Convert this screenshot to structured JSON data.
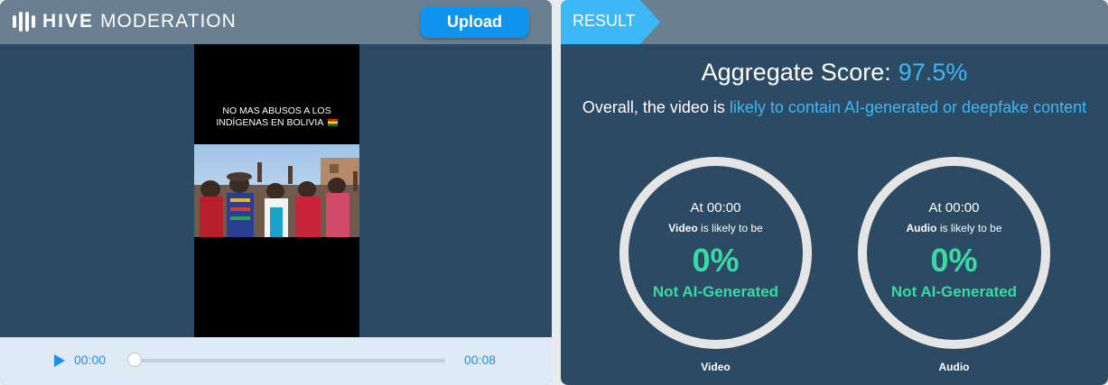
{
  "app": {
    "logo_bold": "HIVE",
    "logo_light": "MODERATION",
    "upload_label": "Upload",
    "logo_icon": "hive-bars-icon"
  },
  "video": {
    "caption_line1": "NO MAS ABUSOS A LOS",
    "caption_line2": "INDÍGENAS EN BOLIVIA",
    "caption_flag": "bolivia-flag-icon",
    "current_time": "00:00",
    "duration": "00:08",
    "progress": 0
  },
  "result": {
    "tag": "RESULT",
    "aggregate_label": "Aggregate Score:",
    "aggregate_value": "97.5%",
    "overall_prefix": "Overall, the video is ",
    "overall_highlight": "likely to contain AI-generated or deepfake content",
    "modalities": [
      {
        "at_label": "At 00:00",
        "name": "Video",
        "likely_suffix": " is likely to be",
        "percent": "0%",
        "verdict": "Not AI-Generated",
        "caption": "Video"
      },
      {
        "at_label": "At 00:00",
        "name": "Audio",
        "likely_suffix": " is likely to be",
        "percent": "0%",
        "verdict": "Not AI-Generated",
        "caption": "Audio"
      }
    ]
  },
  "colors": {
    "panel_bg": "#2c4a63",
    "header_bg": "#6b7f93",
    "accent_blue": "#3bb8f5",
    "upload_blue": "#0f94f0",
    "verdict_green": "#3dd8a8",
    "ring": "#e5e5e5"
  }
}
